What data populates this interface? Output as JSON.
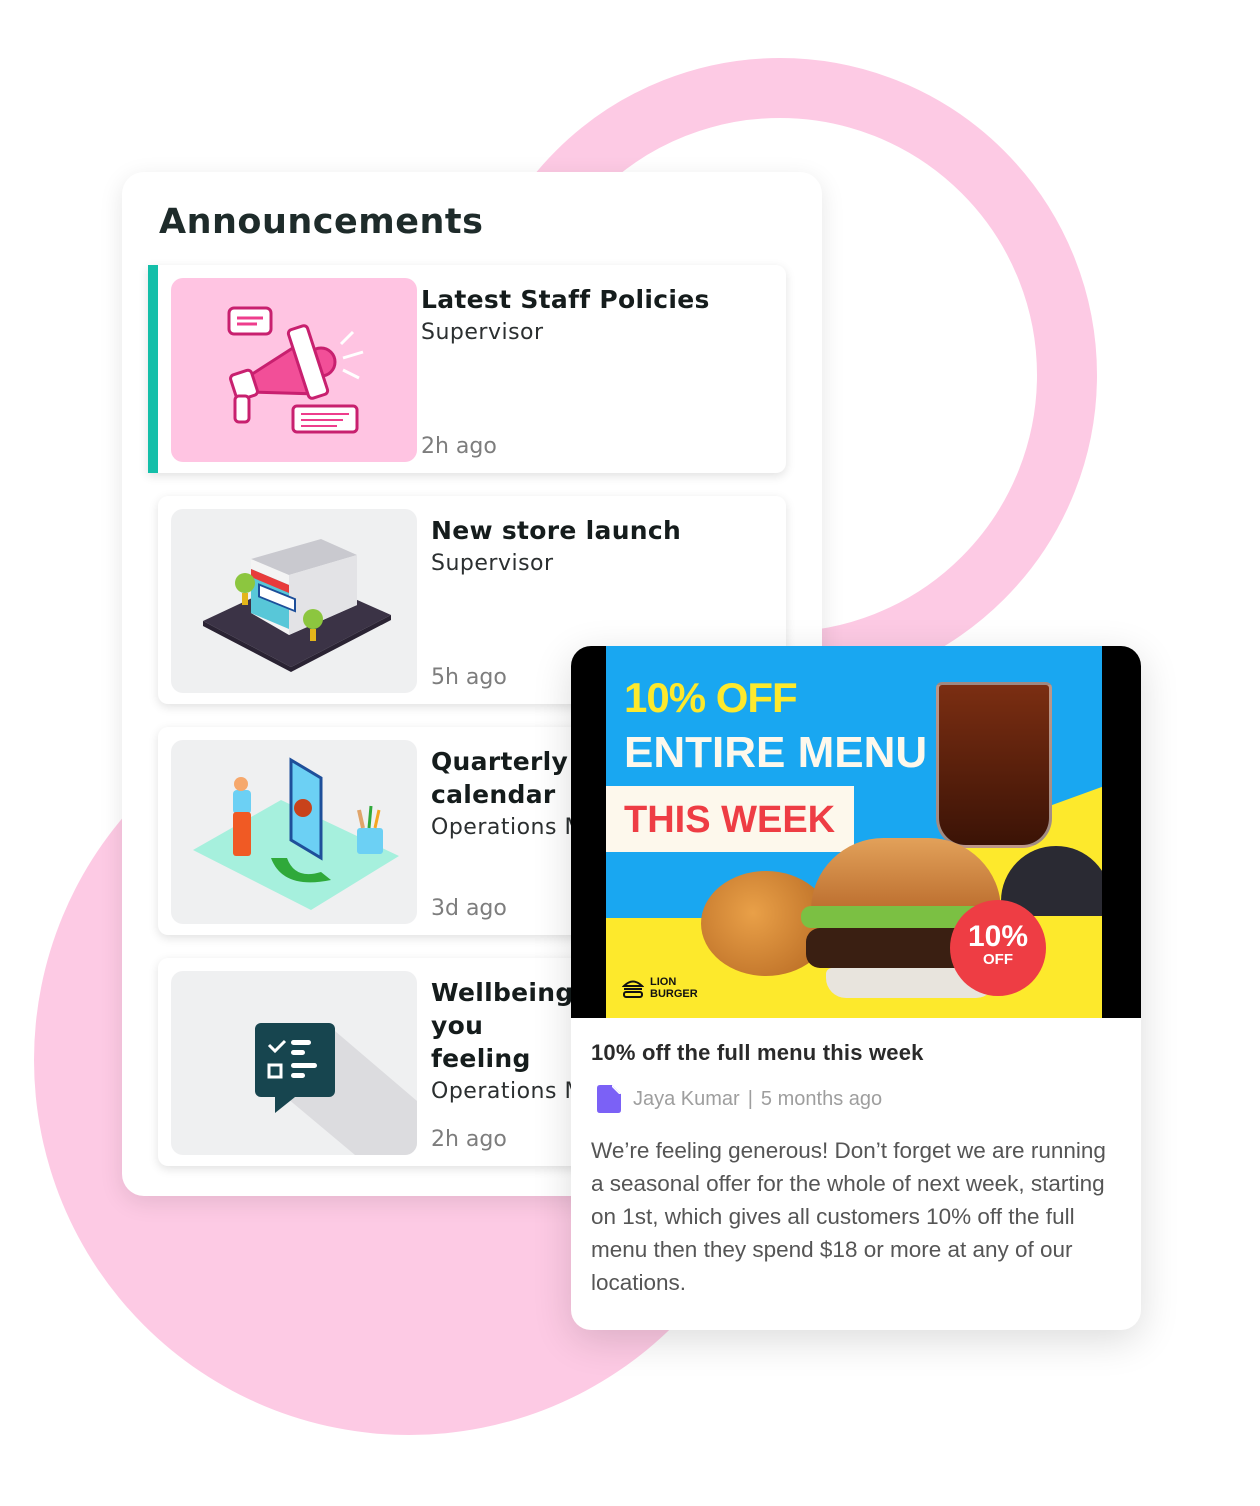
{
  "panel": {
    "title": "Announcements",
    "items": [
      {
        "title": "Latest Staff Policies",
        "author": "Supervisor",
        "time": "2h ago",
        "image": "megaphone-illustration",
        "active": true
      },
      {
        "title": "New store launch",
        "author": "Supervisor",
        "time": "5h ago",
        "image": "store-illustration",
        "active": false
      },
      {
        "title": "Quarterly calendar",
        "author": "Operations M",
        "time": "3d ago",
        "image": "person-phone-illustration",
        "active": false
      },
      {
        "title": "Wellbeing you feeling",
        "author": "Operations M",
        "time": "2h ago",
        "image": "checklist-chat-icon",
        "active": false
      }
    ]
  },
  "promo": {
    "banner": {
      "line1": "10% OFF",
      "line2": "ENTIRE MENU",
      "line3": "THIS WEEK",
      "sticker_pct": "10%",
      "sticker_off": "OFF",
      "brand_line1": "LION",
      "brand_line2": "BURGER"
    },
    "title": "10% off the full menu this week",
    "author": "Jaya Kumar",
    "separator": "|",
    "time": "5 months ago",
    "body": "We’re feeling generous! Don’t forget we are running a seasonal offer for the whole of next week, starting on 1st, which gives all customers 10% off the full menu then they spend $18 or more at any of our locations."
  },
  "colors": {
    "accent": "#14bfa9",
    "background_shape": "#fdcae4",
    "banner_blue": "#19a7f1",
    "banner_yellow": "#fde92c",
    "banner_red": "#ee3d44",
    "doc_icon": "#7b61f6"
  }
}
